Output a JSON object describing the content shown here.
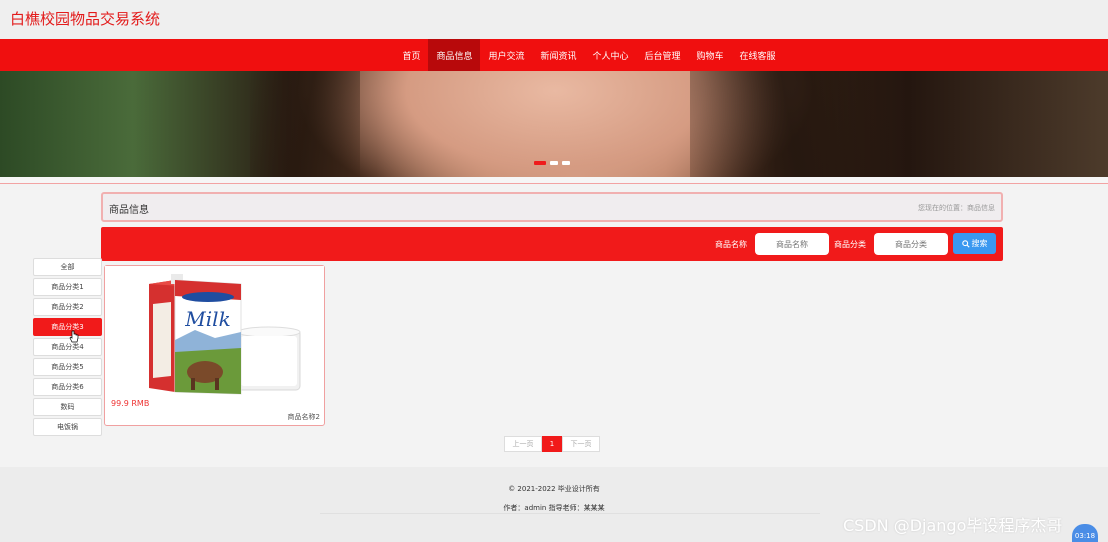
{
  "site": {
    "title": "白樵校园物品交易系统"
  },
  "nav": {
    "items": [
      {
        "label": "首页",
        "active": false
      },
      {
        "label": "商品信息",
        "active": true
      },
      {
        "label": "用户交流",
        "active": false
      },
      {
        "label": "新闻资讯",
        "active": false
      },
      {
        "label": "个人中心",
        "active": false
      },
      {
        "label": "后台管理",
        "active": false
      },
      {
        "label": "购物车",
        "active": false
      },
      {
        "label": "在线客服",
        "active": false
      }
    ]
  },
  "banner": {
    "slide_count": 3,
    "active_slide": 1
  },
  "breadcrumb": {
    "title": "商品信息",
    "location": "您现在的位置：商品信息"
  },
  "search": {
    "name_label": "商品名称",
    "name_placeholder": "商品名称",
    "category_label": "商品分类",
    "category_placeholder": "商品分类",
    "button_label": "搜索"
  },
  "categories": [
    {
      "label": "全部",
      "active": false
    },
    {
      "label": "商品分类1",
      "active": false
    },
    {
      "label": "商品分类2",
      "active": false
    },
    {
      "label": "商品分类3",
      "active": true
    },
    {
      "label": "商品分类4",
      "active": false
    },
    {
      "label": "商品分类5",
      "active": false
    },
    {
      "label": "商品分类6",
      "active": false
    },
    {
      "label": "数码",
      "active": false
    },
    {
      "label": "电饭锅",
      "active": false
    }
  ],
  "products": [
    {
      "price": "99.9 RMB",
      "name": "商品名称2",
      "image": "milk-carton-and-glass"
    }
  ],
  "pagination": {
    "prev": "上一页",
    "current": "1",
    "next": "下一页"
  },
  "footer": {
    "copyright": "© 2021-2022 毕业设计所有",
    "author": "作者：admin 指导老师：某某某"
  },
  "overlay": {
    "watermark": "CSDN @Django毕设程序杰哥",
    "timer": "03:18"
  },
  "colors": {
    "primary": "#f11a1a",
    "nav_active": "#b8090b",
    "search_button": "#3a98f0"
  }
}
